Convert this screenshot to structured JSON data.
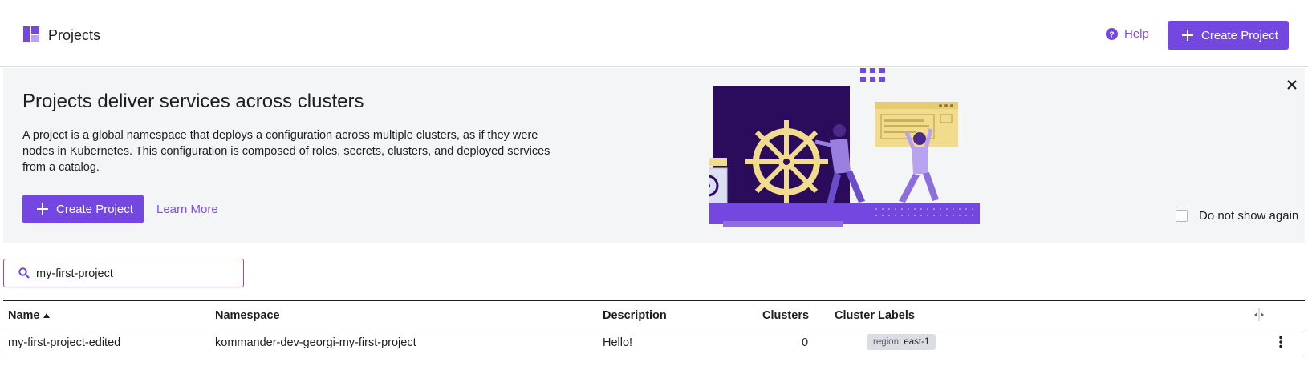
{
  "header": {
    "title": "Projects",
    "logo_icon": "projects-grid-icon",
    "help_label": "Help",
    "create_label": "Create Project"
  },
  "banner": {
    "title": "Projects deliver services across clusters",
    "description": "A project is a global namespace that deploys a configuration across multiple clusters, as if they were nodes in Kubernetes. This configuration is composed of roles, secrets, clusters, and deployed services from a catalog.",
    "create_label": "Create Project",
    "learn_more_label": "Learn More",
    "dont_show_label": "Do not show again",
    "dont_show_checked": false
  },
  "search": {
    "value": "my-first-project"
  },
  "table": {
    "columns": [
      "Name",
      "Namespace",
      "Description",
      "Clusters",
      "Cluster Labels"
    ],
    "sorted_by": "Name",
    "sort_direction": "ascending",
    "rows": [
      {
        "name": "my-first-project-edited",
        "namespace": "kommander-dev-georgi-my-first-project",
        "description": "Hello!",
        "clusters": "0",
        "label_key": "region:",
        "label_value": "east-1"
      }
    ]
  },
  "colors": {
    "accent": "#7447e0",
    "link": "#7c4dff",
    "banner_bg": "#f4f5f7",
    "illustration_dark": "#2b0c5c",
    "illustration_yellow": "#f0dc8c"
  }
}
